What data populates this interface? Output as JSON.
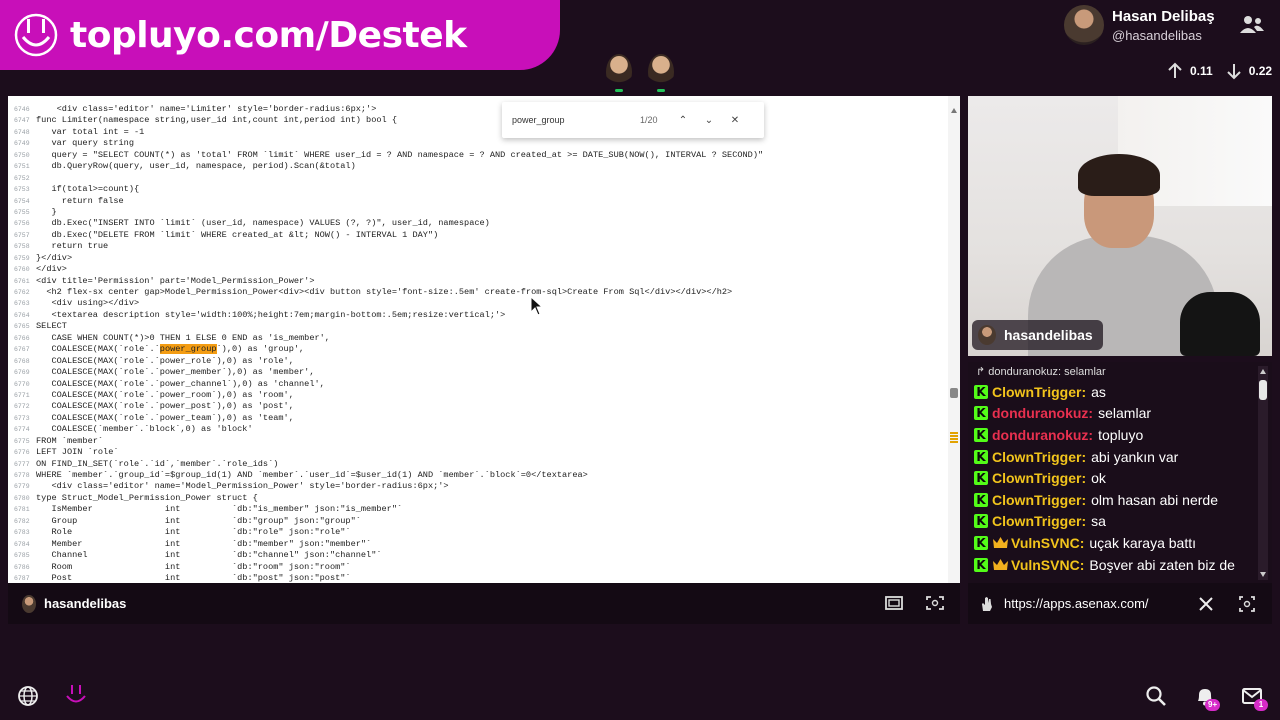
{
  "banner": {
    "text": "topluyo.com/Destek"
  },
  "profile": {
    "name": "Hasan Delibaş",
    "handle": "@hasandelibas"
  },
  "network": {
    "up": "0.11",
    "down": "0.22"
  },
  "find": {
    "query": "power_group",
    "count": "1/20"
  },
  "code_lines": [
    {
      "n": "6746",
      "t": "    <div class='editor' name='Limiter' style='border-radius:6px;'>"
    },
    {
      "n": "6747",
      "t": "func Limiter(namespace string,user_id int,count int,period int) bool {"
    },
    {
      "n": "6748",
      "t": "   var total int = -1"
    },
    {
      "n": "6749",
      "t": "   var query string"
    },
    {
      "n": "6750",
      "t": "   query = \"SELECT COUNT(*) as 'total' FROM `limit` WHERE user_id = ? AND namespace = ? AND created_at >= DATE_SUB(NOW(), INTERVAL ? SECOND)\""
    },
    {
      "n": "6751",
      "t": "   db.QueryRow(query, user_id, namespace, period).Scan(&total)"
    },
    {
      "n": "6752",
      "t": ""
    },
    {
      "n": "6753",
      "t": "   if(total>=count){"
    },
    {
      "n": "6754",
      "t": "     return false"
    },
    {
      "n": "6755",
      "t": "   }"
    },
    {
      "n": "6756",
      "t": "   db.Exec(\"INSERT INTO `limit` (user_id, namespace) VALUES (?, ?)\", user_id, namespace)"
    },
    {
      "n": "6757",
      "t": "   db.Exec(\"DELETE FROM `limit` WHERE created_at &lt; NOW() - INTERVAL 1 DAY\")"
    },
    {
      "n": "6758",
      "t": "   return true"
    },
    {
      "n": "6759",
      "t": "}</div>"
    },
    {
      "n": "6760",
      "t": "</div>"
    },
    {
      "n": "6761",
      "t": "<div title='Permission' part='Model_Permission_Power'>"
    },
    {
      "n": "6762",
      "t": "  <h2 flex-sx center gap>Model_Permission_Power<div><div button style='font-size:.5em' create-from-sql>Create From Sql</div></div></h2>"
    },
    {
      "n": "6763",
      "t": "   <div using></div>"
    },
    {
      "n": "6764",
      "t": "   <textarea description style='width:100%;height:7em;margin-bottom:.5em;resize:vertical;'>"
    },
    {
      "n": "6765",
      "t": "SELECT"
    },
    {
      "n": "6766",
      "t": "   CASE WHEN COUNT(*)>0 THEN 1 ELSE 0 END as 'is_member',"
    },
    {
      "n": "6767",
      "t": "   COALESCE(MAX(`role`.`power_group`),0) as 'group',"
    },
    {
      "n": "6768",
      "t": "   COALESCE(MAX(`role`.`power_role`),0) as 'role',"
    },
    {
      "n": "6769",
      "t": "   COALESCE(MAX(`role`.`power_member`),0) as 'member',"
    },
    {
      "n": "6770",
      "t": "   COALESCE(MAX(`role`.`power_channel`),0) as 'channel',"
    },
    {
      "n": "6771",
      "t": "   COALESCE(MAX(`role`.`power_room`),0) as 'room',"
    },
    {
      "n": "6772",
      "t": "   COALESCE(MAX(`role`.`power_post`),0) as 'post',"
    },
    {
      "n": "6773",
      "t": "   COALESCE(MAX(`role`.`power_team`),0) as 'team',"
    },
    {
      "n": "6774",
      "t": "   COALESCE(`member`.`block`,0) as 'block'"
    },
    {
      "n": "6775",
      "t": "FROM `member`"
    },
    {
      "n": "6776",
      "t": "LEFT JOIN `role`"
    },
    {
      "n": "6777",
      "t": "ON FIND_IN_SET(`role`.`id`,`member`.`role_ids`)"
    },
    {
      "n": "6778",
      "t": "WHERE `member`.`group_id`=$group_id(1) AND `member`.`user_id`=$user_id(1) AND `member`.`block`=0</textarea>"
    },
    {
      "n": "6779",
      "t": "   <div class='editor' name='Model_Permission_Power' style='border-radius:6px;'>"
    },
    {
      "n": "6780",
      "t": "type Struct_Model_Permission_Power struct {"
    },
    {
      "n": "6781",
      "t": "   IsMember              int          `db:\"is_member\" json:\"is_member\"`"
    },
    {
      "n": "6782",
      "t": "   Group                 int          `db:\"group\" json:\"group\"`"
    },
    {
      "n": "6783",
      "t": "   Role                  int          `db:\"role\" json:\"role\"`"
    },
    {
      "n": "6784",
      "t": "   Member                int          `db:\"member\" json:\"member\"`"
    },
    {
      "n": "6785",
      "t": "   Channel               int          `db:\"channel\" json:\"channel\"`"
    },
    {
      "n": "6786",
      "t": "   Room                  int          `db:\"room\" json:\"room\"`"
    },
    {
      "n": "6787",
      "t": "   Post                  int          `db:\"post\" json:\"post\"`"
    }
  ],
  "main_bar": {
    "name": "hasandelibas"
  },
  "cam": {
    "name": "hasandelibas"
  },
  "chat": {
    "reply": "donduranokuz: selamlar",
    "messages": [
      {
        "badge": "kick",
        "user": "ClownTrigger:",
        "color": "#f2c41c",
        "text": "as"
      },
      {
        "badge": "kick",
        "user": "donduranokuz:",
        "color": "#e8304f",
        "text": "selamlar"
      },
      {
        "badge": "kick",
        "user": "donduranokuz:",
        "color": "#e8304f",
        "text": "topluyo"
      },
      {
        "badge": "kick",
        "user": "ClownTrigger:",
        "color": "#f2c41c",
        "text": "abi yankın var"
      },
      {
        "badge": "kick",
        "user": "ClownTrigger:",
        "color": "#f2c41c",
        "text": "ok"
      },
      {
        "badge": "kick",
        "user": "ClownTrigger:",
        "color": "#f2c41c",
        "text": "olm hasan abi nerde"
      },
      {
        "badge": "kick",
        "user": "ClownTrigger:",
        "color": "#f2c41c",
        "text": "sa"
      },
      {
        "badge": "crown",
        "user": "VulnSVNC:",
        "color": "#f2c41c",
        "text": "uçak karaya battı"
      },
      {
        "badge": "crown",
        "user": "VulnSVNC:",
        "color": "#f2c41c",
        "text": "Boşver abi zaten biz de"
      }
    ]
  },
  "url_bar": {
    "url": "https://apps.asenax.com/"
  },
  "taskbar": {
    "bell_badge": "9+",
    "mail_badge": "1"
  }
}
